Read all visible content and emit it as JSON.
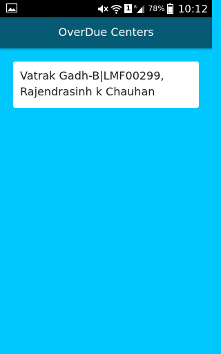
{
  "status_bar": {
    "battery_percent": "78%",
    "time": "10:12",
    "sim_slot": "1",
    "roaming_label": "R",
    "icons": [
      "image-notification-icon",
      "mute-icon",
      "wifi-icon",
      "sim-1-icon",
      "signal-icon",
      "battery-icon"
    ]
  },
  "app_bar": {
    "title": "OverDue Centers",
    "color": "#065a74"
  },
  "background_color": "#00c8ff",
  "centers": [
    {
      "line1": "Vatrak Gadh-B|LMF00299,",
      "line2": "Rajendrasinh k Chauhan"
    }
  ]
}
